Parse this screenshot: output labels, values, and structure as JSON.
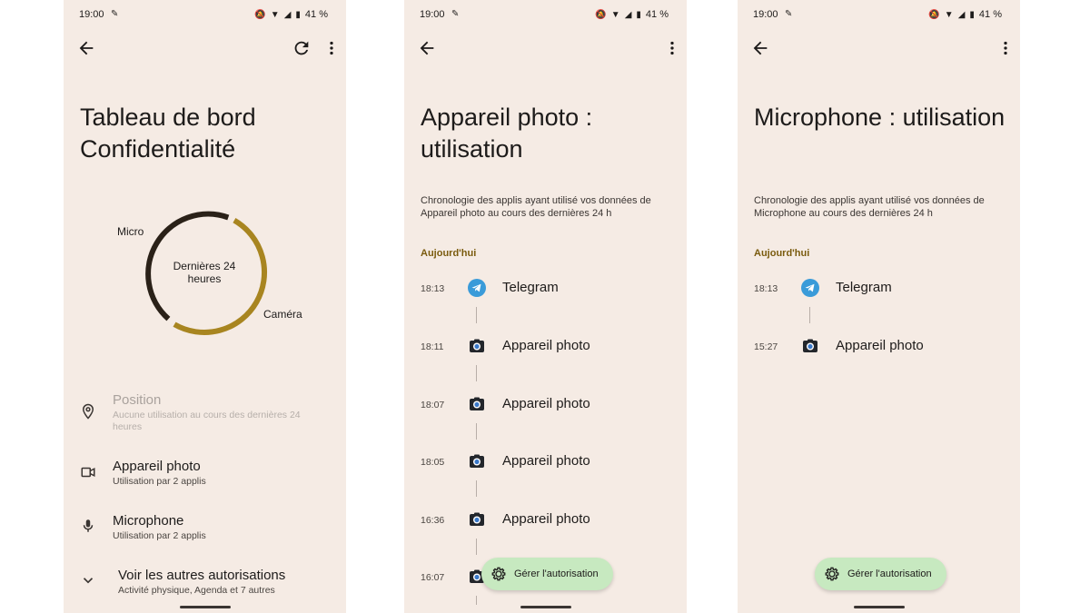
{
  "status": {
    "time": "19:00",
    "battery": "41 %"
  },
  "panel1": {
    "title": "Tableau de bord Confidentialité",
    "chart_center": "Dernières 24 heures",
    "label_micro": "Micro",
    "label_camera": "Caméra",
    "permissions": [
      {
        "title": "Position",
        "subtitle": "Aucune utilisation au cours des dernières 24 heures",
        "icon": "location-pin-icon",
        "disabled": true
      },
      {
        "title": "Appareil photo",
        "subtitle": "Utilisation par 2 applis",
        "icon": "videocam-icon",
        "disabled": false
      },
      {
        "title": "Microphone",
        "subtitle": "Utilisation par 2 applis",
        "icon": "mic-icon",
        "disabled": false
      },
      {
        "title": "Voir les autres autorisations",
        "subtitle": "Activité physique, Agenda et 7 autres",
        "icon": "chevron-down-icon",
        "disabled": false
      }
    ]
  },
  "panel2": {
    "title": "Appareil photo : utilisation",
    "description": "Chronologie des applis ayant utilisé vos données de Appareil photo au cours des dernières 24 h",
    "section": "Aujourd'hui",
    "entries": [
      {
        "time": "18:13",
        "app": "Telegram",
        "icon": "telegram-icon"
      },
      {
        "time": "18:11",
        "app": "Appareil photo",
        "icon": "camera-icon"
      },
      {
        "time": "18:07",
        "app": "Appareil photo",
        "icon": "camera-icon"
      },
      {
        "time": "18:05",
        "app": "Appareil photo",
        "icon": "camera-icon"
      },
      {
        "time": "16:36",
        "app": "Appareil photo",
        "icon": "camera-icon"
      },
      {
        "time": "16:07",
        "app": "",
        "icon": "camera-icon"
      }
    ],
    "fab_label": "Gérer l'autorisation"
  },
  "panel3": {
    "title": "Microphone : utilisation",
    "description": "Chronologie des applis ayant utilisé vos données de Microphone au cours des dernières 24 h",
    "section": "Aujourd'hui",
    "entries": [
      {
        "time": "18:13",
        "app": "Telegram",
        "icon": "telegram-icon"
      },
      {
        "time": "15:27",
        "app": "Appareil photo",
        "icon": "camera-icon"
      }
    ],
    "fab_label": "Gérer l'autorisation"
  },
  "colors": {
    "background": "#f5ebe4",
    "camera_arc": "#a88520",
    "micro_arc": "#2a2118",
    "fab": "#c7e9c0",
    "accent_section": "#7a5b0e",
    "telegram": "#3a9bd9"
  }
}
